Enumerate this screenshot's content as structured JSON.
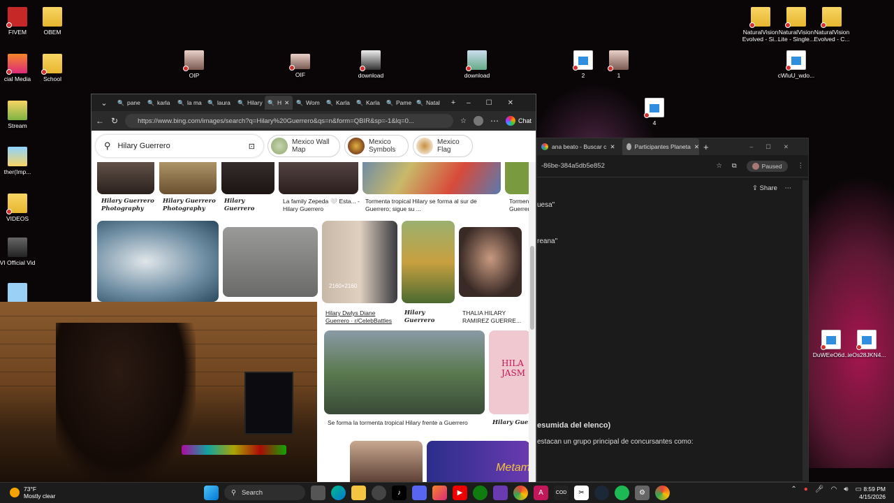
{
  "desktop": {
    "icons": [
      {
        "label": "FIVEM"
      },
      {
        "label": "OBEM"
      },
      {
        "label": "cial Media"
      },
      {
        "label": "School"
      },
      {
        "label": "Stream"
      },
      {
        "label": "ther(Imp..."
      },
      {
        "label": "VIDEOS"
      },
      {
        "label": "VI Official Vid"
      },
      {
        "label": "OIP"
      },
      {
        "label": "OIF"
      },
      {
        "label": "download"
      },
      {
        "label": "download"
      },
      {
        "label": "2"
      },
      {
        "label": "1"
      },
      {
        "label": "4"
      },
      {
        "label": "NaturalVision Evolved - Si..."
      },
      {
        "label": "NaturalVision Lite - Single..."
      },
      {
        "label": "NaturalVision Evolved - C..."
      },
      {
        "label": "cWluU_wdo..."
      },
      {
        "label": "DuWEeO6d..."
      },
      {
        "label": "ieOs28JKN4..."
      }
    ]
  },
  "browser": {
    "tabs": [
      "pane",
      "karla",
      "la ma",
      "laura",
      "Hilary",
      "H",
      "Wom",
      "Karla",
      "Karla",
      "Pame",
      "Natal"
    ],
    "url": "https://www.bing.com/images/search?q=Hilary%20Guerrero&qs=n&form=QBIR&sp=-1&lq=0...",
    "chat_label": "Chat",
    "search_query": "Hilary Guerrero",
    "chips": [
      {
        "label": "Mexico Wall Map"
      },
      {
        "label": "Mexico Symbols"
      },
      {
        "label": "Mexico Flag"
      }
    ],
    "row1_captions": [
      "Hilary Guerrero Photography",
      "Hilary Guerrero Photography",
      "Hilary Guerrero",
      "La family Zepeda 🤍 Esta... - Hilary Guerrero",
      "Tormenta tropical Hilary se forma al sur de Guerrero; sigue su ...",
      "Tormen Guerrer"
    ],
    "row2_captions": [
      "Hilary Dwlys Diane Guerrero · r/CelebBattles",
      "Hilary Guerrero",
      "THALIA HILARY RAMIREZ GUERRE..."
    ],
    "row2_overlay": "2160×2160",
    "row3_captions": [
      "Se forma la tormenta tropical Hilary frente a Guerrero",
      "Hilary Guer"
    ],
    "row3_promo": "HILA JASM",
    "row4_promo": "Metam"
  },
  "dark_window": {
    "tabs": [
      "ana beato - Buscar c",
      "Participantes Planeta"
    ],
    "url_fragment": "-86be-384a5db5e852",
    "paused_label": "Paused",
    "share_label": "Share",
    "texts": [
      "uesa\"",
      "reana\"",
      "esumida del elenco)",
      "estacan un grupo principal de concursantes como:"
    ]
  },
  "taskbar": {
    "temp": "73°F",
    "condition": "Mostly clear",
    "search_label": "Search",
    "time": "8:59 PM",
    "date": "4/15/2026"
  }
}
